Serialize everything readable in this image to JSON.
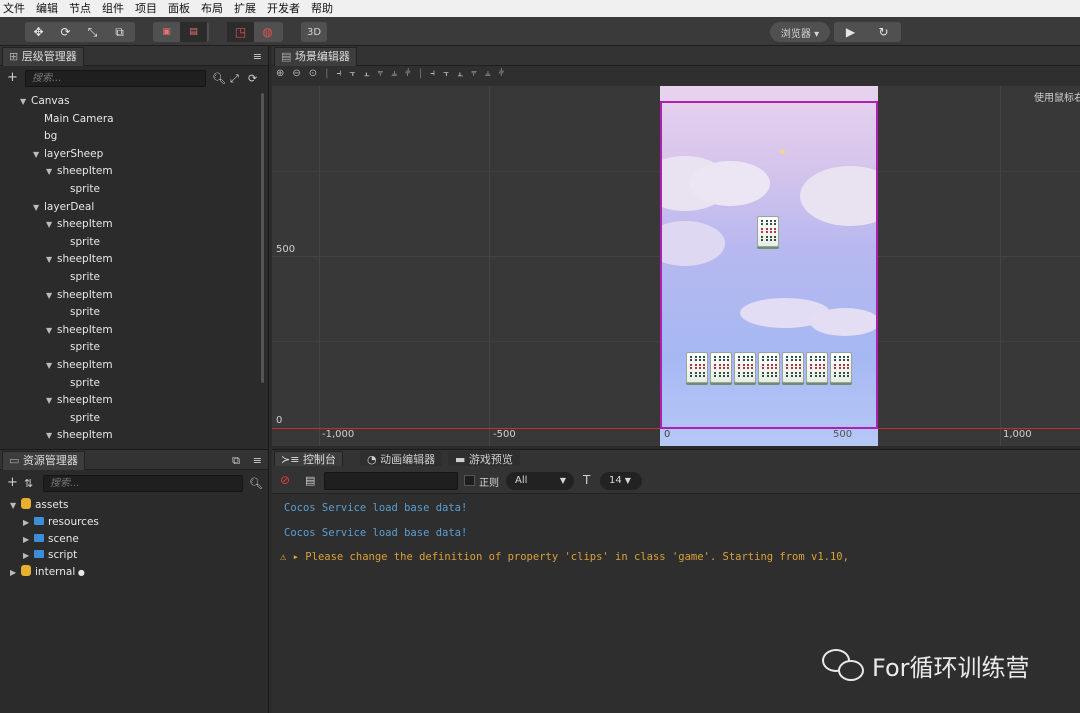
{
  "menu": [
    "文件",
    "编辑",
    "节点",
    "组件",
    "项目",
    "面板",
    "布局",
    "扩展",
    "开发者",
    "帮助"
  ],
  "toolbar": {
    "transform_icons": [
      "move-icon",
      "rotate-icon",
      "scale-icon",
      "rect-icon"
    ],
    "pivot_icons": [
      "pivot-icon",
      "local-icon"
    ],
    "view_icons": [
      "2d-rect-icon",
      "globe-icon"
    ],
    "mode_3d": "3D",
    "browser_label": "浏览器 ▾",
    "play_icon": "▶",
    "refresh_icon": "↻"
  },
  "hierarchy": {
    "title": "层级管理器",
    "search_placeholder": "搜索...",
    "nodes": [
      {
        "label": "Canvas",
        "depth": 0,
        "expanded": true
      },
      {
        "label": "Main Camera",
        "depth": 1,
        "expanded": null
      },
      {
        "label": "bg",
        "depth": 1,
        "expanded": null
      },
      {
        "label": "layerSheep",
        "depth": 1,
        "expanded": true
      },
      {
        "label": "sheepItem",
        "depth": 2,
        "expanded": true
      },
      {
        "label": "sprite",
        "depth": 3,
        "expanded": null
      },
      {
        "label": "layerDeal",
        "depth": 1,
        "expanded": true
      },
      {
        "label": "sheepItem",
        "depth": 2,
        "expanded": true
      },
      {
        "label": "sprite",
        "depth": 3,
        "expanded": null
      },
      {
        "label": "sheepItem",
        "depth": 2,
        "expanded": true
      },
      {
        "label": "sprite",
        "depth": 3,
        "expanded": null
      },
      {
        "label": "sheepItem",
        "depth": 2,
        "expanded": true
      },
      {
        "label": "sprite",
        "depth": 3,
        "expanded": null
      },
      {
        "label": "sheepItem",
        "depth": 2,
        "expanded": true
      },
      {
        "label": "sprite",
        "depth": 3,
        "expanded": null
      },
      {
        "label": "sheepItem",
        "depth": 2,
        "expanded": true
      },
      {
        "label": "sprite",
        "depth": 3,
        "expanded": null
      },
      {
        "label": "sheepItem",
        "depth": 2,
        "expanded": true
      },
      {
        "label": "sprite",
        "depth": 3,
        "expanded": null
      },
      {
        "label": "sheepItem",
        "depth": 2,
        "expanded": true
      }
    ]
  },
  "scene": {
    "title": "场景编辑器",
    "hint": "使用鼠标右",
    "y_labels": [
      "500",
      "0"
    ],
    "x_labels": [
      "-1,000",
      "-500",
      "0",
      "500",
      "1,000"
    ]
  },
  "assets": {
    "title": "资源管理器",
    "search_placeholder": "搜索...",
    "items": [
      {
        "label": "assets",
        "depth": 0,
        "kind": "db",
        "expanded": true,
        "lock": false
      },
      {
        "label": "resources",
        "depth": 1,
        "kind": "folder",
        "expanded": false,
        "lock": false
      },
      {
        "label": "scene",
        "depth": 1,
        "kind": "folder",
        "expanded": false,
        "lock": false
      },
      {
        "label": "script",
        "depth": 1,
        "kind": "folder",
        "expanded": false,
        "lock": false
      },
      {
        "label": "internal",
        "depth": 0,
        "kind": "db",
        "expanded": false,
        "lock": true
      }
    ]
  },
  "console": {
    "tabs": [
      "控制台",
      "动画编辑器",
      "游戏预览"
    ],
    "regex_label": "正则",
    "filter_value": "All",
    "font_size": "14",
    "logs": [
      {
        "text": "Cocos Service load base data!",
        "level": "info"
      },
      {
        "text": "Cocos Service load base data!",
        "level": "info"
      },
      {
        "text": "Please change the definition of property 'clips' in class 'game'. Starting from v1.10,",
        "level": "warn"
      }
    ]
  },
  "watermark": "For循环训练营",
  "colors": {
    "accent": "#b020b0",
    "info": "#5a9fd4",
    "warn": "#d9a13a",
    "axis": "#c03030"
  }
}
